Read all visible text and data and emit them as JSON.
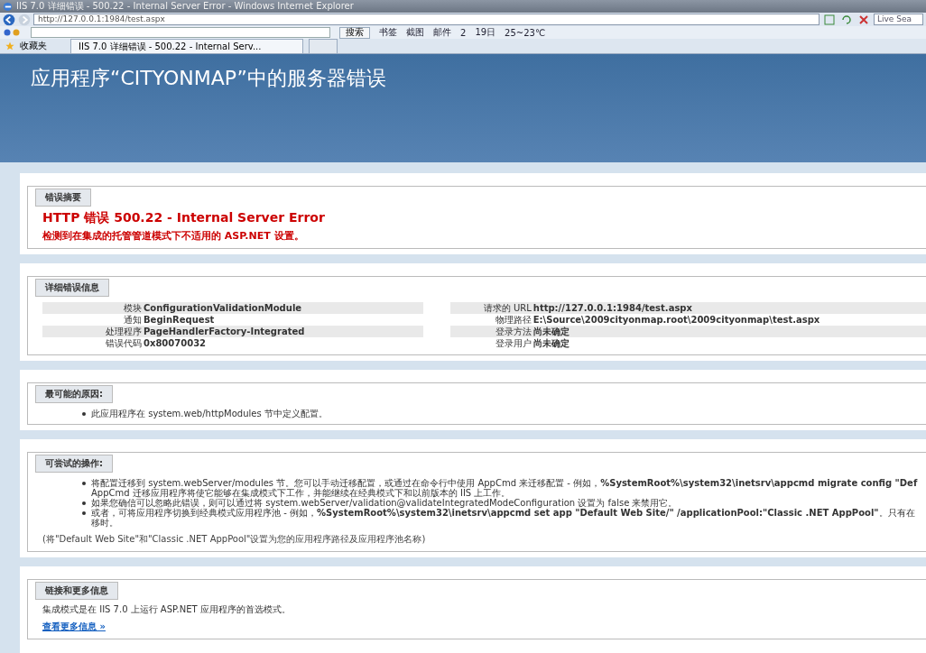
{
  "window": {
    "title": "IIS 7.0 详细错误 - 500.22 - Internal Server Error - Windows Internet Explorer"
  },
  "address_bar": {
    "url": "http://127.0.0.1:1984/test.aspx",
    "search_placeholder": "Live Sea"
  },
  "search_toolbar": {
    "search_button": "搜索",
    "items": [
      "书签",
      "截图",
      "邮件",
      "2",
      "19日",
      "25~23℃"
    ]
  },
  "favorites_bar": {
    "favorites": "收藏夹",
    "tab": "IIS 7.0 详细错误 - 500.22 - Internal Serv..."
  },
  "page": {
    "heading": "应用程序“CITYONMAP”中的服务器错误",
    "summary": {
      "legend": "错误摘要",
      "title": "HTTP 错误 500.22 - Internal Server Error",
      "subtitle": "检测到在集成的托管管道模式下不适用的 ASP.NET 设置。"
    },
    "details": {
      "legend": "详细错误信息",
      "left": [
        {
          "label": "模块",
          "value": "ConfigurationValidationModule"
        },
        {
          "label": "通知",
          "value": "BeginRequest"
        },
        {
          "label": "处理程序",
          "value": "PageHandlerFactory-Integrated"
        },
        {
          "label": "错误代码",
          "value": "0x80070032"
        }
      ],
      "right": [
        {
          "label": "请求的 URL",
          "value": "http://127.0.0.1:1984/test.aspx"
        },
        {
          "label": "物理路径",
          "value": "E:\\Source\\2009cityonmap.root\\2009cityonmap\\test.aspx"
        },
        {
          "label": "登录方法",
          "value": "尚未确定"
        },
        {
          "label": "登录用户",
          "value": "尚未确定"
        }
      ]
    },
    "causes": {
      "legend": "最可能的原因:",
      "items": [
        [
          "此应用程序在 system.web/httpModules 节中定义配置。"
        ]
      ]
    },
    "actions": {
      "legend": "可尝试的操作:",
      "items": [
        [
          "将配置迁移到 system.webServer/modules 节。您可以手动迁移配置，或通过在命令行中使用 AppCmd 来迁移配置 - 例如，**%SystemRoot%\\system32\\inetsrv\\appcmd migrate config \"Def**",
          "AppCmd 迁移应用程序将使它能够在集成模式下工作，并能继续在经典模式下和以前版本的 IIS 上工作。"
        ],
        [
          "如果您确信可以忽略此错误，则可以通过将 system.webServer/validation@validateIntegratedModeConfiguration 设置为 false 来禁用它。"
        ],
        [
          "或者，可将应用程序切换到经典模式应用程序池 - 例如，**%SystemRoot%\\system32\\inetsrv\\appcmd set app \"Default Web Site/\" /applicationPool:\"Classic .NET AppPool\"**。只有在",
          "移时。"
        ]
      ],
      "note": "(将\"Default Web Site\"和\"Classic .NET AppPool\"设置为您的应用程序路径及应用程序池名称)"
    },
    "links": {
      "legend": "链接和更多信息",
      "text": "集成模式是在 IIS 7.0 上运行 ASP.NET 应用程序的首选模式。",
      "link": "查看更多信息 »"
    }
  }
}
